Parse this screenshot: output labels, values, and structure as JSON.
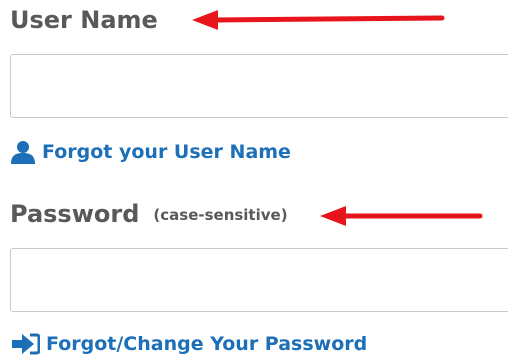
{
  "username": {
    "label": "User Name",
    "value": "",
    "forgot_link": "Forgot your User Name",
    "forgot_icon": "user-icon"
  },
  "password": {
    "label": "Password",
    "note": "(case-sensitive)",
    "value": "",
    "forgot_link": "Forgot/Change Your Password",
    "forgot_icon": "sign-in-arrow-icon"
  },
  "colors": {
    "label": "#58595b",
    "link": "#1d6fb8",
    "annotation_arrow": "#e8141c",
    "field_border": "#c9c9c9"
  }
}
